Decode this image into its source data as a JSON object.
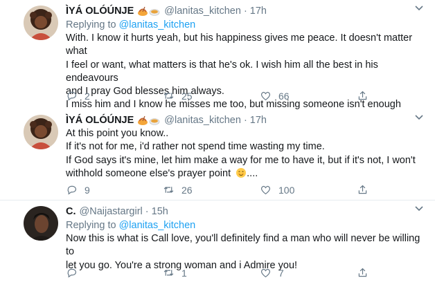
{
  "tweets": [
    {
      "name": "ÌYÁ OLÓÚNJE",
      "handle": "@lanitas_kitchen",
      "time": "17h",
      "replying_prefix": "Replying to",
      "replying_to": "@lanitas_kitchen",
      "lines": [
        "With. I know it hurts yeah, but his happiness gives me peace. It doesn't matter what",
        "I feel or want, what matters is that he's ok. I wish him all the best in his endeavours",
        "and I pray God blesses him always.",
        "I miss him and I know he misses me too, but missing someone isn't enough"
      ],
      "replies": "2",
      "retweets": "25",
      "likes": "66"
    },
    {
      "name": "ÌYÁ OLÓÚNJE",
      "handle": "@lanitas_kitchen",
      "time": "17h",
      "lines": [
        "At this point you know..",
        "If it's not for me, i'd rather not spend time wasting my time.",
        "If God says it's mine, let him make a way for me to have it, but if it's not, I won't",
        "withhold someone else's prayer point",
        "...."
      ],
      "replies": "9",
      "retweets": "26",
      "likes": "100"
    },
    {
      "name": "C.",
      "handle": "@Naijastargirl",
      "time": "15h",
      "replying_prefix": "Replying to",
      "replying_to": "@lanitas_kitchen",
      "lines": [
        "Now this is what is Call love, you'll definitely find a man who will never be willing to",
        "let you go. You're a strong woman and i Admire you!"
      ],
      "replies": "",
      "retweets": "1",
      "likes": "7"
    }
  ],
  "icons": {
    "reply": "reply-icon",
    "retweet": "retweet-icon",
    "like": "like-icon",
    "share": "share-icon",
    "caret": "chevron-down-icon",
    "food_emoji": "food-emoji-icon",
    "smile_emoji": "smiling-face-emoji-icon"
  },
  "colors": {
    "link": "#1da1f2",
    "secondary_text": "#657786",
    "primary_text": "#14171a"
  }
}
